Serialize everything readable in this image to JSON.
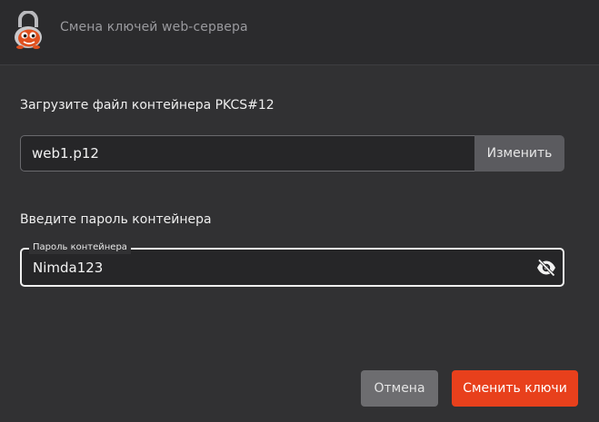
{
  "window": {
    "title": "Смена ключей web-сервера",
    "logo_icon": "padlock-mascot-icon"
  },
  "upload": {
    "label": "Загрузите файл контейнера PKCS#12",
    "file_value": "web1.p12",
    "change_label": "Изменить"
  },
  "password": {
    "label": "Введите пароль контейнера",
    "field_legend": "Пароль контейнера",
    "value": "Nimda123",
    "visibility_icon": "eye-off-icon"
  },
  "actions": {
    "cancel_label": "Отмена",
    "submit_label": "Сменить ключи"
  },
  "colors": {
    "accent": "#e8401c",
    "background": "#313133",
    "secondary_button": "#6d6d70"
  }
}
